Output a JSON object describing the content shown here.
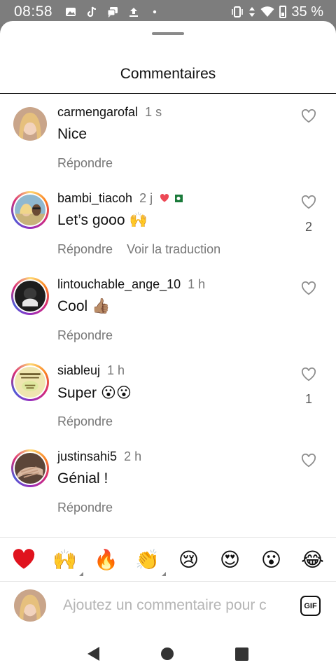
{
  "status_bar": {
    "time": "08:58",
    "battery": "35 %"
  },
  "sheet": {
    "title": "Commentaires"
  },
  "comments": [
    {
      "username": "carmengarofal",
      "time": "1 s",
      "text": "Nice",
      "emoji": "",
      "actions": [
        "Répondre"
      ],
      "likes": ""
    },
    {
      "username": "bambi_tiacoh",
      "time": "2 j",
      "text": "Let’s gooo",
      "emoji": "🙌",
      "actions": [
        "Répondre",
        "Voir la traduction"
      ],
      "likes": "2"
    },
    {
      "username": "lintouchable_ange_10",
      "time": "1 h",
      "text": "Cool",
      "emoji": "👍🏽",
      "actions": [
        "Répondre"
      ],
      "likes": ""
    },
    {
      "username": "siableuj",
      "time": "1 h",
      "text": "Super",
      "emoji": "😮😮",
      "actions": [
        "Répondre"
      ],
      "likes": "1"
    },
    {
      "username": "justinsahi5",
      "time": "2 h",
      "text": "Génial !",
      "emoji": "",
      "actions": [
        "Répondre"
      ],
      "likes": ""
    }
  ],
  "emoji_bar": [
    "❤️",
    "🙌",
    "🔥",
    "👏",
    "😢",
    "😍",
    "😮",
    "😂"
  ],
  "composer": {
    "placeholder": "Ajoutez un commentaire pour c",
    "gif_label": "GIF"
  },
  "colors": {
    "like_heart": "#ed4956",
    "story_ring": "#d62976",
    "muted_text": "#777777"
  }
}
